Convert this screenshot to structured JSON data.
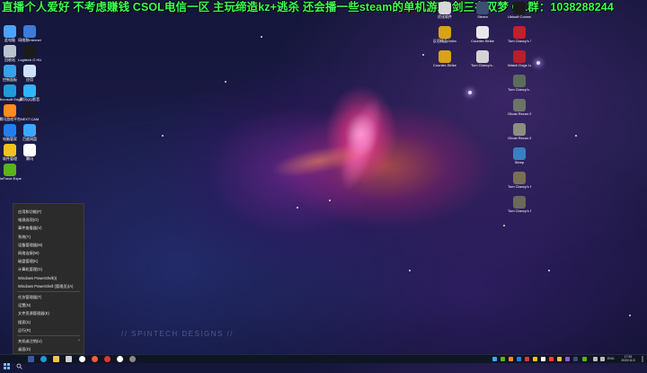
{
  "overlay": {
    "stream_title": "直播个人爱好 不考虑赚钱 CSOL电信一区 主玩缔造kz+逃杀 还会播一些steam的单机游戏 剑三在双梦 OL群：1038288244"
  },
  "wallpaper": {
    "watermark": "// SPINTECH DESIGNS //"
  },
  "desktop": {
    "left_icons": [
      {
        "label": "此电脑",
        "icon": "computer-icon",
        "color": "#4aa3ff"
      },
      {
        "label": "网络和Internet",
        "icon": "network-icon",
        "color": "#3b7dd8"
      },
      {
        "label": "回收站",
        "icon": "recycle-bin-icon",
        "color": "#b9c4d0"
      },
      {
        "label": "Logitech G HUB",
        "icon": "logitech-icon",
        "color": "#1b1b1b"
      },
      {
        "label": "控制面板",
        "icon": "control-panel-icon",
        "color": "#36a3e8"
      },
      {
        "label": "应用",
        "icon": "app-icon",
        "color": "#cfe0ff"
      },
      {
        "label": "Microsoft Edge",
        "icon": "edge-icon",
        "color": "#1f9bd9"
      },
      {
        "label": "腾讯QQ影音",
        "icon": "player-icon",
        "color": "#2fb4ff"
      },
      {
        "label": "腾讯游戏平台",
        "icon": "game-platform-icon",
        "color": "#ff8a1f"
      },
      {
        "label": "NEXT CAM",
        "icon": "camera-icon",
        "color": "#1b1b2b"
      },
      {
        "label": "电脑管家",
        "icon": "shield-icon",
        "color": "#1f7ff0"
      },
      {
        "label": "百度网盘",
        "icon": "cloud-icon",
        "color": "#3ba7ff"
      },
      {
        "label": "软件管理",
        "icon": "store-icon",
        "color": "#f2c21a"
      },
      {
        "label": "腾讯",
        "icon": "tencent-icon",
        "color": "#ffffff"
      },
      {
        "label": "GeForce Experience",
        "icon": "nvidia-icon",
        "color": "#5bb31b"
      }
    ],
    "right_icons": [
      {
        "label": "优化软件",
        "icon": "steam-icon",
        "color": "#d8d8d8"
      },
      {
        "label": "Steam",
        "icon": "steam-icon",
        "color": "#3a4f72"
      },
      {
        "label": "Ubisoft Connect",
        "icon": "ubisoft-icon",
        "color": "#1a1a1a"
      },
      {
        "label": "反恐精英Online",
        "icon": "csol-icon",
        "color": "#d8a21a"
      },
      {
        "label": "Counter-Strike",
        "icon": "cs-icon",
        "color": "#e8e8e8"
      },
      {
        "label": "Tom Clancy's The...",
        "icon": "tom-clancy-icon",
        "color": "#c41f2a"
      },
      {
        "label": "Counter-Strike Global Off...",
        "icon": "csgo-icon",
        "color": "#d8a21a"
      },
      {
        "label": "Tom Clancy's...",
        "icon": "rainbow-icon",
        "color": "#d4d4d4"
      },
      {
        "label": "Watch Dogs Legion",
        "icon": "watch-dogs-icon",
        "color": "#b81f2a"
      },
      {
        "label": "Tom Clancy's...",
        "icon": "tom-clancy-icon",
        "color": "#5c6c5c"
      },
      {
        "label": "Ghost Recon B...",
        "icon": "ghost-recon-icon",
        "color": "#6e7468"
      },
      {
        "label": "Ghost Recon B...",
        "icon": "ghost-recon-icon",
        "color": "#8d8d80"
      },
      {
        "label": "Steep",
        "icon": "steep-icon",
        "color": "#3a7fc1"
      },
      {
        "label": "Tom Clancy's R...",
        "icon": "tom-clancy-icon",
        "color": "#7a6f55"
      },
      {
        "label": "Tom Clancy's R...",
        "icon": "tom-clancy-icon",
        "color": "#6a6a5a"
      }
    ]
  },
  "start_menu": {
    "items": [
      "应用和功能(F)",
      "电源选项(O)",
      "事件查看器(V)",
      "系统(Y)",
      "设备管理器(M)",
      "网络连接(W)",
      "磁盘管理(K)",
      "计算机管理(G)",
      "Windows PowerShell(I)",
      "Windows PowerShell (管理员)(A)",
      "任务管理器(T)",
      "设置(N)",
      "文件资源管理器(E)",
      "搜索(S)",
      "运行(R)",
      "关机或注销(U)",
      "桌面(D)"
    ],
    "submenu_arrow": "›"
  },
  "taskbar": {
    "tray_language": "ENG",
    "clock_time": "17:53",
    "clock_date": "2020/11/3"
  },
  "colors": {
    "title_green": "#3cff52",
    "menu_bg": "#2b2b2b",
    "taskbar_bg": "#101524"
  }
}
